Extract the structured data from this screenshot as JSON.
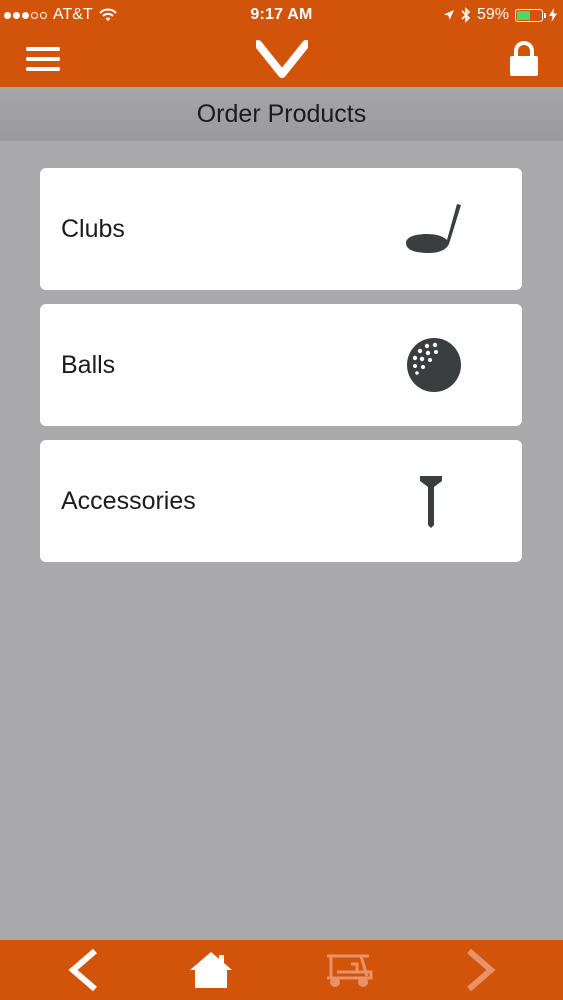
{
  "status_bar": {
    "carrier": "AT&T",
    "time": "9:17 AM",
    "battery_percent": "59%",
    "battery_level": 0.59,
    "signal_bars_filled": 3,
    "signal_bars_total": 5
  },
  "nav": {
    "menu_icon": "hamburger-icon",
    "logo_icon": "chevron-logo-icon",
    "lock_icon": "lock-icon"
  },
  "page": {
    "title": "Order Products"
  },
  "categories": [
    {
      "label": "Clubs",
      "icon": "golf-club-icon"
    },
    {
      "label": "Balls",
      "icon": "golf-ball-icon"
    },
    {
      "label": "Accessories",
      "icon": "golf-tee-icon"
    }
  ],
  "tab_bar": {
    "back_icon": "chevron-left-icon",
    "home_icon": "home-icon",
    "cart_icon": "golf-cart-icon",
    "forward_icon": "chevron-right-icon"
  },
  "colors": {
    "brand_orange": "#d2530a",
    "background_gray": "#a9a9ab",
    "header_gray": "#9e9ea0",
    "icon_dark": "#3a3e3f",
    "battery_green": "#4cd964",
    "disabled_icon": "#e8926a"
  }
}
